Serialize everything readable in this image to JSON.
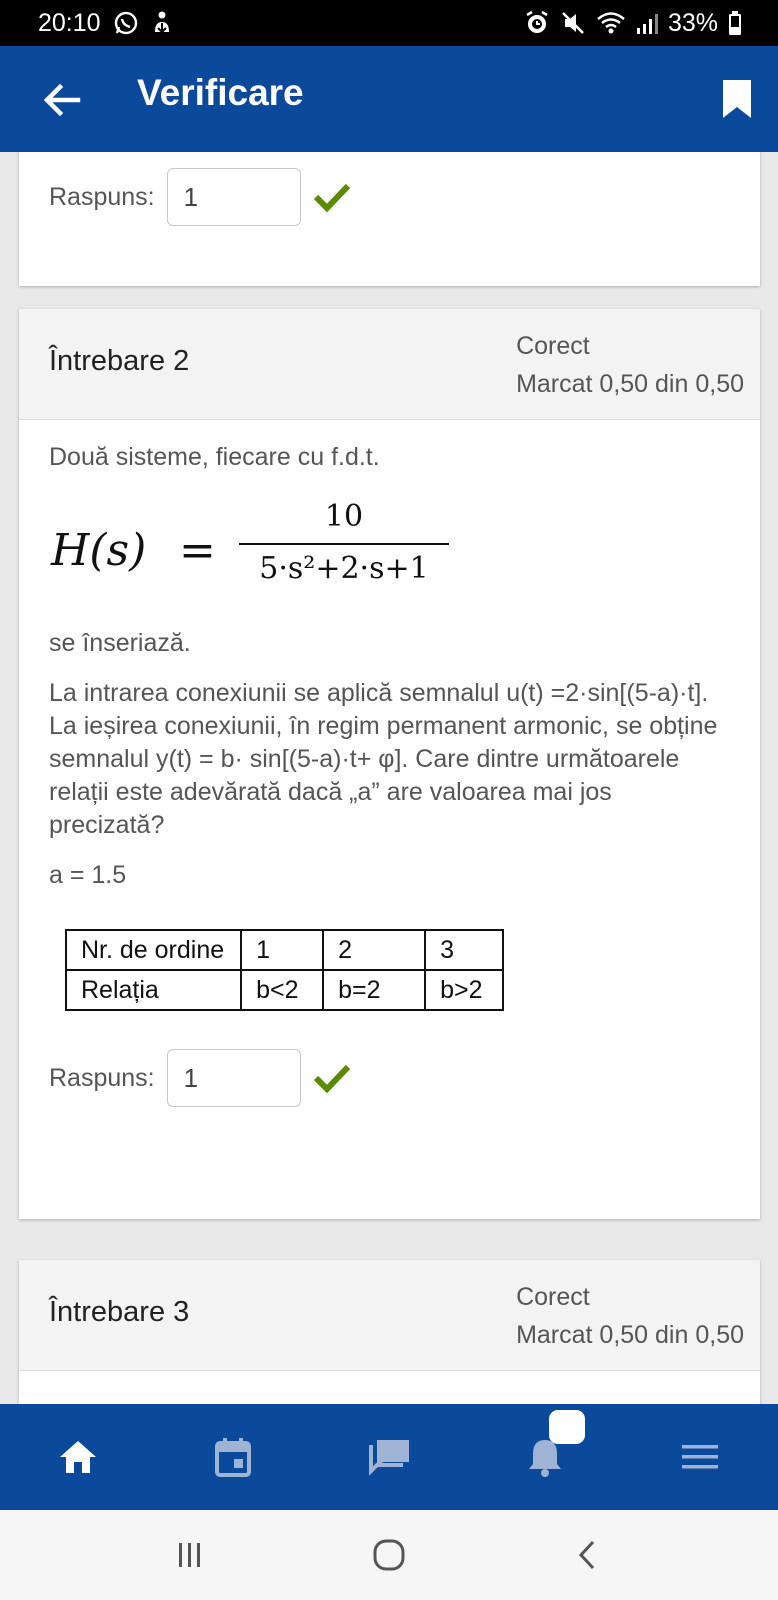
{
  "status_bar": {
    "time": "20:10",
    "battery": "33%"
  },
  "app_bar": {
    "title": "Verificare"
  },
  "question1": {
    "answer_label": "Raspuns:",
    "answer_value": "1"
  },
  "question2": {
    "title": "Întrebare 2",
    "state": "Corect",
    "grade": "Marcat 0,50 din 0,50",
    "intro": "Două sisteme, fiecare cu f.d.t.",
    "formula": {
      "lhs": "H(s)",
      "eq": "=",
      "numerator": "10",
      "denominator": "5·s²+2·s+1"
    },
    "after_formula": "se înseriază.",
    "body": "La intrarea conexiunii se aplică semnalul u(t) =2·sin[(5-a)·t]. La ieșirea conexiunii, în regim permanent armonic, se obține semnalul y(t) = b· sin[(5-a)·t+ φ]. Care dintre următoarele relații este adevărată dacă „a” are valoarea mai jos precizată?",
    "param": "a = 1.5",
    "table": {
      "row1": [
        "Nr. de ordine",
        "1",
        "2",
        "3"
      ],
      "row2": [
        "Relația",
        "b<2",
        "b=2",
        "b>2"
      ]
    },
    "answer_label": "Raspuns:",
    "answer_value": "1"
  },
  "question3": {
    "title": "Întrebare 3",
    "state": "Corect",
    "grade": "Marcat 0,50 din 0,50"
  },
  "colors": {
    "primary": "#0b4a9b",
    "check": "#5a8a00"
  },
  "bottom_nav_icons": [
    "home-icon",
    "calendar-icon",
    "messages-icon",
    "notifications-icon",
    "menu-icon"
  ],
  "system_nav_icons": [
    "recents-icon",
    "home-circle-icon",
    "back-chevron-icon"
  ]
}
